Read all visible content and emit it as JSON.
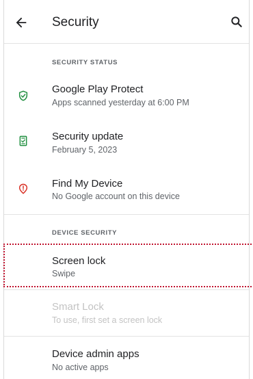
{
  "app_bar": {
    "title": "Security",
    "back_icon": "arrow-back-icon",
    "search_icon": "search-icon"
  },
  "security_status": {
    "header": "SECURITY STATUS",
    "items": [
      {
        "title": "Google Play Protect",
        "subtitle": "Apps scanned yesterday at 6:00 PM",
        "icon": "shield-check-icon",
        "icon_color": "#1e8e3e"
      },
      {
        "title": "Security update",
        "subtitle": "February 5, 2023",
        "icon": "phone-check-icon",
        "icon_color": "#1e8e3e"
      },
      {
        "title": "Find My Device",
        "subtitle": "No Google account on this device",
        "icon": "location-alert-icon",
        "icon_color": "#d93025"
      }
    ]
  },
  "device_security": {
    "header": "DEVICE SECURITY",
    "items": [
      {
        "title": "Screen lock",
        "subtitle": "Swipe",
        "enabled": true
      },
      {
        "title": "Smart Lock",
        "subtitle": "To use, first set a screen lock",
        "enabled": false
      },
      {
        "title": "Device admin apps",
        "subtitle": "No active apps",
        "enabled": true
      }
    ]
  },
  "highlight_color": "#c0112d"
}
